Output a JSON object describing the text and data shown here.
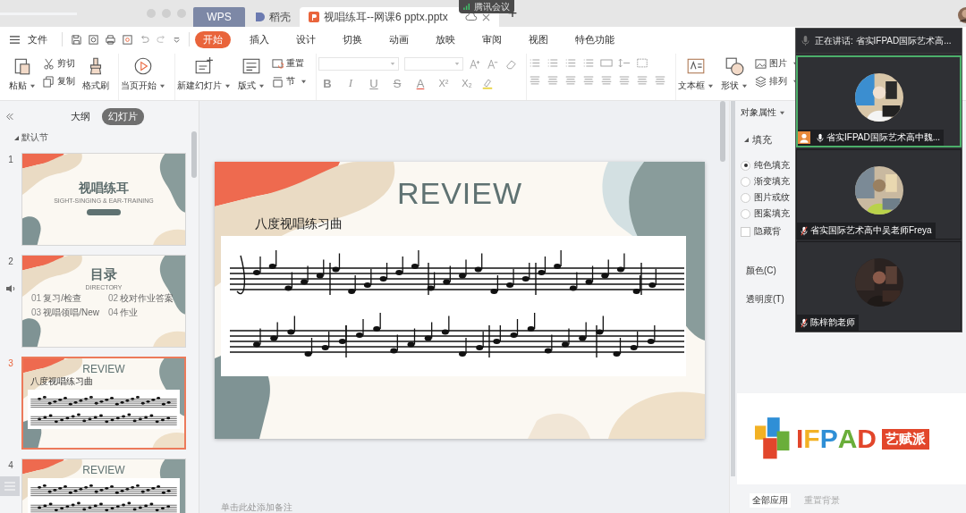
{
  "top_bar": {
    "tabs": [
      {
        "label": "WPS",
        "kind": "home",
        "selected": false
      },
      {
        "label": "稻壳",
        "kind": "docer",
        "selected": false
      },
      {
        "label": "视唱练耳--网课6 pptx.pptx",
        "kind": "file",
        "selected": true
      }
    ],
    "new_tab": "+",
    "meeting_badge": "腾讯会议"
  },
  "menu": {
    "file": "文件",
    "tabs": [
      {
        "label": "开始",
        "selected": true
      },
      {
        "label": "插入",
        "selected": false
      },
      {
        "label": "设计",
        "selected": false
      },
      {
        "label": "切换",
        "selected": false
      },
      {
        "label": "动画",
        "selected": false
      },
      {
        "label": "放映",
        "selected": false
      },
      {
        "label": "审阅",
        "selected": false
      },
      {
        "label": "视图",
        "selected": false
      },
      {
        "label": "特色功能",
        "selected": false
      }
    ]
  },
  "ribbon": {
    "paste": "粘贴",
    "cut": "剪切",
    "copy": "复制",
    "format_painter": "格式刷",
    "play": "当页开始",
    "new_slide": "新建幻灯片",
    "layout": "版式",
    "reset": "重置",
    "section": "节",
    "format_buttons": [
      "B",
      "I",
      "U",
      "S",
      "A",
      "X²",
      "X₂"
    ],
    "text_box": "文本框",
    "shape": "形状",
    "picture": "图片",
    "arrange": "排列"
  },
  "left_panel": {
    "tabs": [
      {
        "label": "大纲",
        "selected": false
      },
      {
        "label": "幻灯片",
        "selected": true
      }
    ],
    "section": "默认节",
    "slides": [
      {
        "number": "1",
        "kind": "title",
        "selected": false,
        "audio": false,
        "title": "视唱练耳",
        "subtitle": "SIGHT-SINGING & EAR-TRAINING"
      },
      {
        "number": "2",
        "kind": "contents",
        "selected": false,
        "audio": true,
        "title": "目录",
        "subtitle": "DIRECTORY",
        "items": [
          {
            "num": "01",
            "text": "复习/检查"
          },
          {
            "num": "02",
            "text": "校对作业答案"
          },
          {
            "num": "03",
            "text": "视唱领唱/New"
          },
          {
            "num": "04",
            "text": "作业"
          }
        ]
      },
      {
        "number": "3",
        "kind": "score",
        "selected": true,
        "audio": false,
        "title": "REVIEW",
        "caption": "八度视唱练习曲"
      },
      {
        "number": "4",
        "kind": "score",
        "selected": false,
        "audio": false,
        "title": "REVIEW"
      }
    ]
  },
  "slide": {
    "title": "REVIEW",
    "caption": "八度视唱练习曲"
  },
  "notes_placeholder": "单击此处添加备注",
  "right_panel": {
    "title": "对象属性",
    "section": "填充",
    "fill_options": [
      {
        "label": "纯色填充",
        "selected": true
      },
      {
        "label": "渐变填充",
        "selected": false
      },
      {
        "label": "图片或纹",
        "selected": false
      },
      {
        "label": "图案填充",
        "selected": false
      }
    ],
    "hide_background": {
      "label": "隐藏背",
      "checked": false
    },
    "color_label": "颜色(C)",
    "opacity_label": "透明度(T)",
    "logo": {
      "letters": [
        {
          "text": "I",
          "color": "#e2462b"
        },
        {
          "text": "F",
          "color": "#f2b124"
        },
        {
          "text": "P",
          "color": "#2f8fd6"
        },
        {
          "text": "A",
          "color": "#6aae3a"
        },
        {
          "text": "D",
          "color": "#e2462b"
        }
      ],
      "tag": "艺赋派"
    },
    "apply_all": "全部应用",
    "reset_background": {
      "label": "重置背景",
      "disabled": true
    }
  },
  "meeting": {
    "speaking": "正在讲话: 省实IFPAD国际艺术高...",
    "participants": [
      {
        "name": "省实IFPAD国际艺术高中魏...",
        "speaking": true,
        "muted": false
      },
      {
        "name": "省实国际艺术高中吴老师Freya",
        "speaking": false,
        "muted": true
      },
      {
        "name": "陈梓韵老师",
        "speaking": false,
        "muted": true
      }
    ]
  }
}
